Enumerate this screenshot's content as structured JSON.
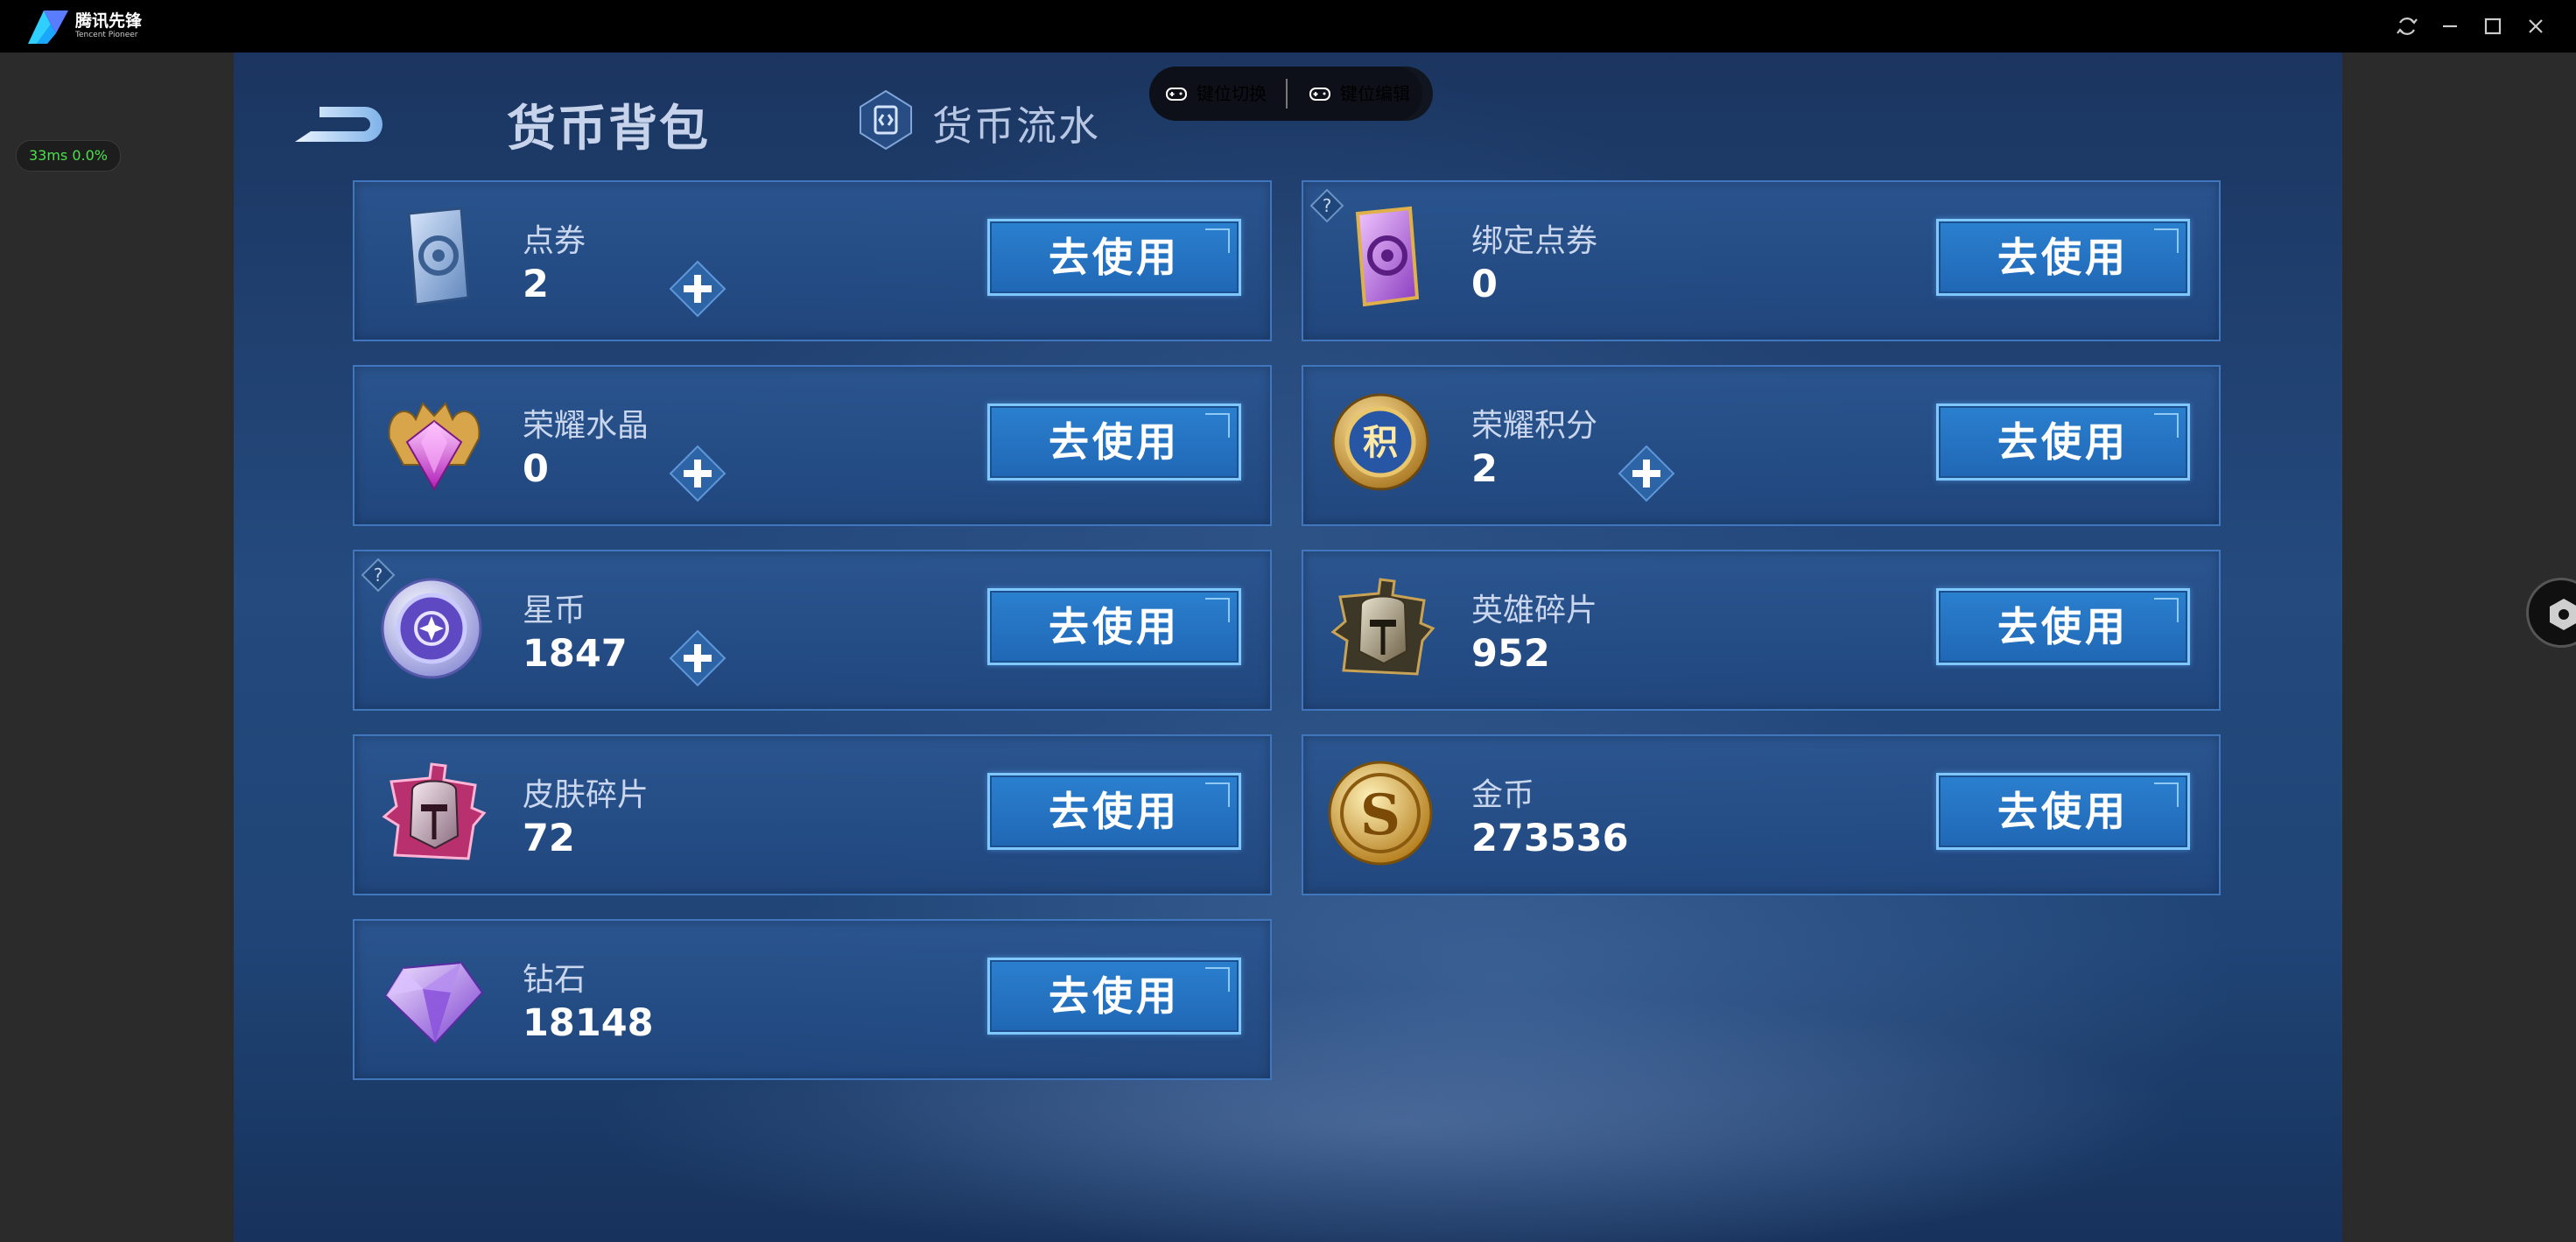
{
  "app": {
    "brand_cn": "腾讯先锋",
    "brand_en": "Tencent Pioneer",
    "window_controls": [
      "refresh-icon",
      "minimize-icon",
      "maximize-icon",
      "close-icon"
    ]
  },
  "side": {
    "perf": "33ms  0.0%"
  },
  "keybar": {
    "switch_label": "键位切换",
    "edit_label": "键位编辑"
  },
  "header": {
    "title": "货币背包",
    "flow_tab": "货币流水"
  },
  "cards": [
    {
      "name": "点券",
      "value": "2",
      "button": "去使用",
      "icon": "coupon-card-icon"
    },
    {
      "name": "绑定点券",
      "value": "0",
      "button": "去使用",
      "icon": "bound-coupon-card-icon"
    },
    {
      "name": "荣耀水晶",
      "value": "0",
      "button": "去使用",
      "icon": "glory-crystal-icon"
    },
    {
      "name": "荣耀积分",
      "value": "2",
      "button": "去使用",
      "icon": "glory-points-coin-icon"
    },
    {
      "name": "星币",
      "value": "1847",
      "button": "去使用",
      "icon": "star-coin-icon"
    },
    {
      "name": "英雄碎片",
      "value": "952",
      "button": "去使用",
      "icon": "hero-fragment-icon"
    },
    {
      "name": "皮肤碎片",
      "value": "72",
      "button": "去使用",
      "icon": "skin-fragment-icon"
    },
    {
      "name": "金币",
      "value": "273536",
      "button": "去使用",
      "icon": "gold-coin-icon"
    },
    {
      "name": "钻石",
      "value": "18148",
      "button": "去使用",
      "icon": "diamond-icon"
    }
  ],
  "colors": {
    "background": "#214478",
    "card": "#2b5691",
    "card_border": "#3f76bd",
    "button": "#2a80cf",
    "button_border": "#7ec8ff",
    "perf_text": "#4be04b"
  }
}
